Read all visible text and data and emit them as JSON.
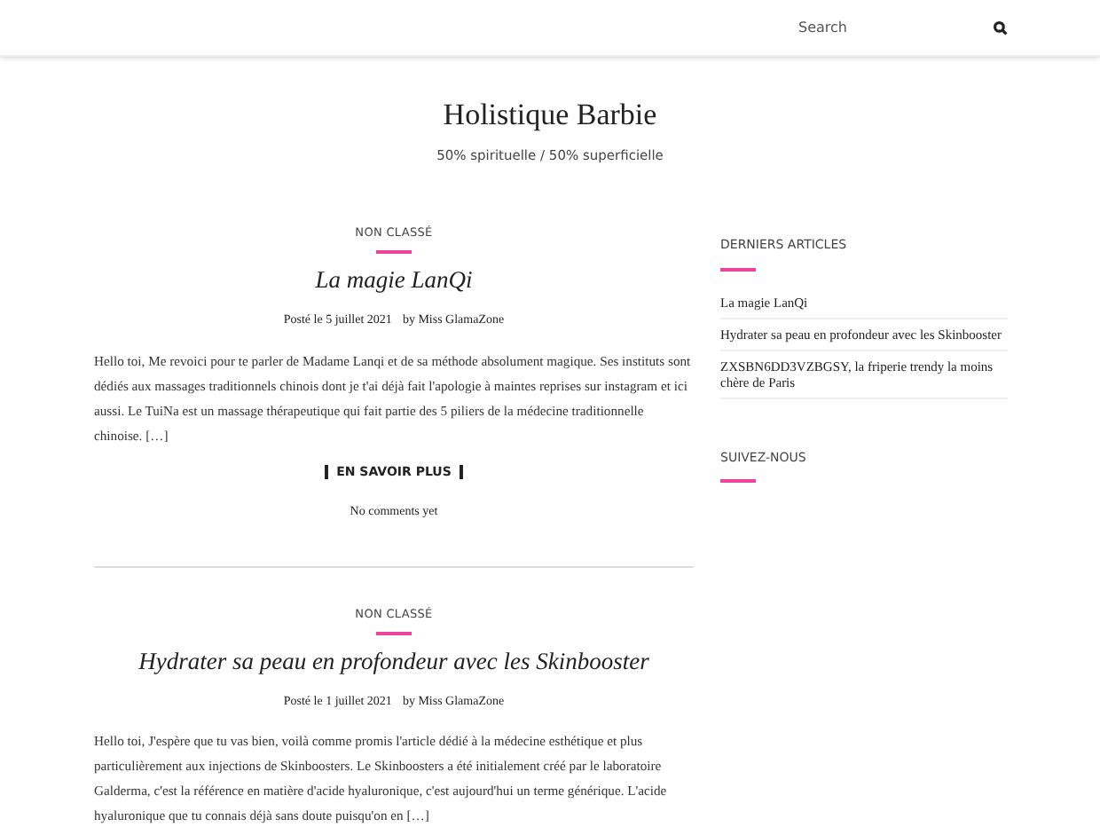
{
  "search": {
    "placeholder": "Search"
  },
  "site": {
    "title": "Holistique Barbie",
    "tagline": "50% spirituelle / 50% superficielle"
  },
  "posts": [
    {
      "category": "NON CLASSÉ",
      "title": "La magie LanQi",
      "posted": "Posté le 5 juillet 2021",
      "by": "by Miss GlamaZone",
      "excerpt": "Hello toi, Me revoici pour te parler de Madame Lanqi et de sa méthode absolument magique. Ses instituts sont dédiés aux massages traditionnels chinois dont je t'ai déjà fait l'apologie à maintes reprises sur instagram et ici aussi. Le TuiNa est un massage thérapeutique qui fait partie des 5 piliers de la médecine traditionnelle chinoise. […]",
      "more": "EN SAVOIR PLUS",
      "comments": "No comments yet"
    },
    {
      "category": "NON CLASSÉ",
      "title": "Hydrater sa peau en profondeur avec les Skinbooster",
      "posted": "Posté le 1 juillet 2021",
      "by": "by Miss GlamaZone",
      "excerpt": "Hello toi, J'espère que tu vas bien, voilà comme promis l'article dédié à la médecine esthétique et plus particulièrement aux injections de Skinboosters. Le Skinboosters a été initialement créé par le laboratoire Galderma, c'est la référence en matière d'acide hyaluronique, c'est aujourd'hui un terme générique. L'acide hyaluronique que tu connais déjà sans doute puisqu'on en […]"
    }
  ],
  "sidebar": {
    "recent_title": "DERNIERS ARTICLES",
    "recent": [
      "La magie LanQi",
      "Hydrater sa peau en profondeur avec les Skinbooster",
      "ZXSBN6DD3VZBGSY, la friperie trendy la moins chère de Paris"
    ],
    "follow_title": "SUIVEZ-NOUS"
  }
}
